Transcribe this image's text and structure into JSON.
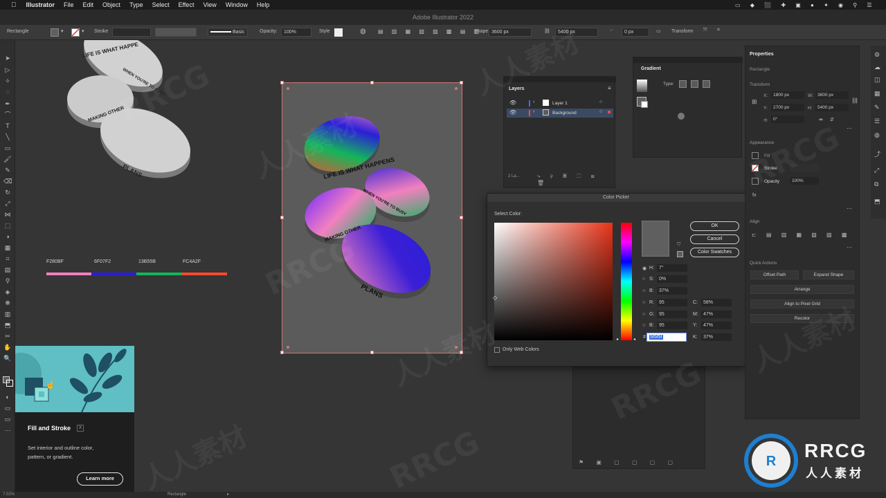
{
  "menubar": {
    "apple": "",
    "items": [
      "Illustrator",
      "File",
      "Edit",
      "Object",
      "Type",
      "Select",
      "Effect",
      "View",
      "Window",
      "Help"
    ]
  },
  "titlebar": {
    "title": "Adobe Illustrator 2022"
  },
  "control_bar": {
    "object_type": "Rectangle",
    "stroke_label": "Stroke",
    "stroke_profile": "Basic",
    "opacity_label": "Opacity:",
    "opacity_value": "100%",
    "style_label": "Style",
    "shape_label": "Shape",
    "width": "3600 px",
    "height": "5400 px",
    "corner": "0 px",
    "transform_label": "Transform"
  },
  "canvas": {
    "art_left": {
      "top_text": "LIFE IS WHAT HAPPE",
      "side_text": "WHEN YOU'RE TO BUSY",
      "middle_text": "MAKING OTHER",
      "bottom_text": "PLANS"
    },
    "art_center": {
      "top_text": "LIFE IS WHAT HAPPENS",
      "side_text": "WHEN YOU'RE TO BUSY",
      "middle_text": "MAKING OTHER",
      "bottom_text": "PLANS"
    },
    "swatches": [
      {
        "label": "F280BF",
        "color": "#F280BF"
      },
      {
        "label": "6F07F2",
        "color": "#2a1fd6"
      },
      {
        "label": "13B55B",
        "color": "#13B55B"
      },
      {
        "label": "FC4A2F",
        "color": "#FC4A2F"
      }
    ]
  },
  "layers_panel": {
    "title": "Layers",
    "layers": [
      {
        "name": "Layer 1",
        "color": "#4a6cff"
      },
      {
        "name": "Background",
        "color": "#ff4a4a"
      }
    ],
    "footer": "2 La..."
  },
  "gradient_panel": {
    "title": "Gradient",
    "type_label": "Type:"
  },
  "color_picker": {
    "title": "Color Picker",
    "select_label": "Select Color:",
    "ok": "OK",
    "cancel": "Cancel",
    "swatches_btn": "Color Swatches",
    "hsb": [
      {
        "k": "H:",
        "v": "7°"
      },
      {
        "k": "S:",
        "v": "0%"
      },
      {
        "k": "B:",
        "v": "37%"
      }
    ],
    "rgb": [
      {
        "k": "R:",
        "v": "95"
      },
      {
        "k": "G:",
        "v": "95"
      },
      {
        "k": "B:",
        "v": "95"
      }
    ],
    "cmyk": [
      {
        "k": "C:",
        "v": "58%"
      },
      {
        "k": "M:",
        "v": "47%"
      },
      {
        "k": "Y:",
        "v": "47%"
      },
      {
        "k": "K:",
        "v": "37%"
      }
    ],
    "hex_label": "#",
    "hex_value": "5f5f5f",
    "only_web": "Only Web Colors",
    "current_color": "#5f5f5f"
  },
  "properties_panel": {
    "title": "Properties",
    "object": "Rectangle",
    "transform_label": "Transform",
    "x": "1800 px",
    "y": "2700 px",
    "w": "3600 px",
    "h": "5400 px",
    "angle": "0°",
    "appearance_label": "Appearance",
    "fill_label": "Fill",
    "stroke_label": "Stroke",
    "opacity_label": "Opacity",
    "opacity_value": "100%",
    "align_label": "Align",
    "quick_actions_label": "Quick Actions",
    "offset_path": "Offset Path",
    "expand_shape": "Expand Shape",
    "arrange": "Arrange",
    "align_pixel": "Align to Pixel Grid",
    "recolor": "Recolor"
  },
  "tooltip": {
    "title": "Fill and Stroke",
    "shortcut": "X",
    "desc": "Set interior and outline color, pattern, or gradient.",
    "learn_more": "Learn more"
  },
  "statusbar": {
    "zoom": "7.02%",
    "tool": "Rectangle"
  },
  "watermark": {
    "text1": "RRCG",
    "text2": "人人素材",
    "logo_text": "RRCG",
    "logo_sub": "人人素材"
  }
}
